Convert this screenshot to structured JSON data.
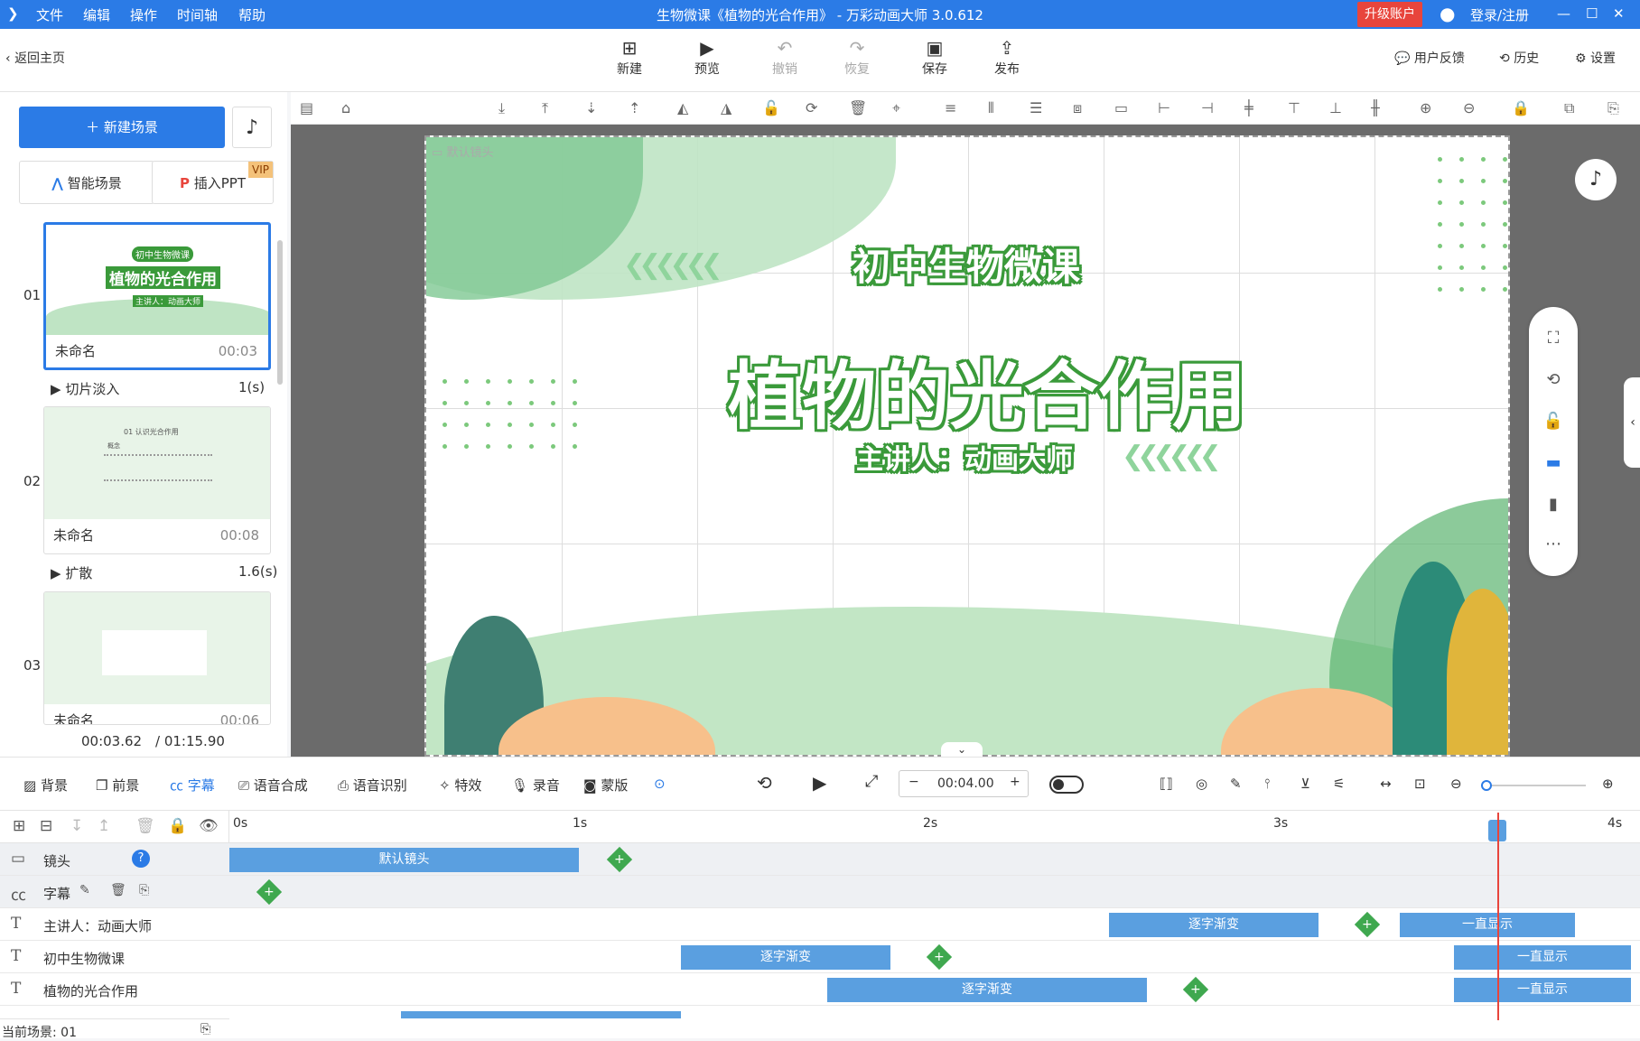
{
  "app": {
    "title": "生物微课《植物的光合作用》 - 万彩动画大师 3.0.612",
    "menu": [
      "文件",
      "编辑",
      "操作",
      "时间轴",
      "帮助"
    ],
    "upgrade": "升级账户",
    "login": "登录/注册"
  },
  "toolbar": {
    "back": "返回主页",
    "new": "新建",
    "preview": "预览",
    "undo": "撤销",
    "redo": "恢复",
    "save": "保存",
    "publish": "发布",
    "feedback": "用户反馈",
    "history": "历史",
    "settings": "设置"
  },
  "left": {
    "new_scene": "新建场景",
    "smart_scene": "智能场景",
    "insert_ppt": "插入PPT",
    "vip": "VIP",
    "scenes": [
      {
        "num": "01",
        "name": "未命名",
        "dur": "00:03",
        "trans": "切片淡入",
        "trans_dur": "1(s)"
      },
      {
        "num": "02",
        "name": "未命名",
        "dur": "00:08",
        "trans": "扩散",
        "trans_dur": "1.6(s)"
      },
      {
        "num": "03",
        "name": "未命名",
        "dur": "00:06"
      }
    ],
    "time_current": "00:03.62",
    "time_total": "/ 01:15.90"
  },
  "stage": {
    "camera_label": "默认镜头",
    "subtitle": "初中生物微课",
    "title": "植物的光合作用",
    "presenter": "主讲人：动画大师",
    "thumb_tag": "初中生物微课",
    "thumb_title": "植物的光合作用",
    "thumb_sub": "主讲人：动画大师",
    "thumb2_head": "01 认识光合作用",
    "thumb2_sub": "概念"
  },
  "bottom": {
    "bg": "背景",
    "fg": "前景",
    "subtitle": "字幕",
    "tts": "语音合成",
    "asr": "语音识别",
    "effects": "特效",
    "record": "录音",
    "mask": "蒙版",
    "time": "00:04.00"
  },
  "timeline": {
    "ticks": [
      "0s",
      "1s",
      "2s",
      "3s",
      "4s"
    ],
    "rows": [
      {
        "label": "镜头"
      },
      {
        "label": "字幕"
      },
      {
        "label": "主讲人：动画大师"
      },
      {
        "label": "初中生物微课"
      },
      {
        "label": "植物的光合作用"
      }
    ],
    "seg_camera": "默认镜头",
    "seg_fade": "逐字渐变",
    "seg_show": "一直显示",
    "current_scene": "当前场景: 01"
  },
  "colors": {
    "accent": "#2b7be6",
    "green": "#3a9a3a",
    "upgrade": "#e8453c"
  }
}
